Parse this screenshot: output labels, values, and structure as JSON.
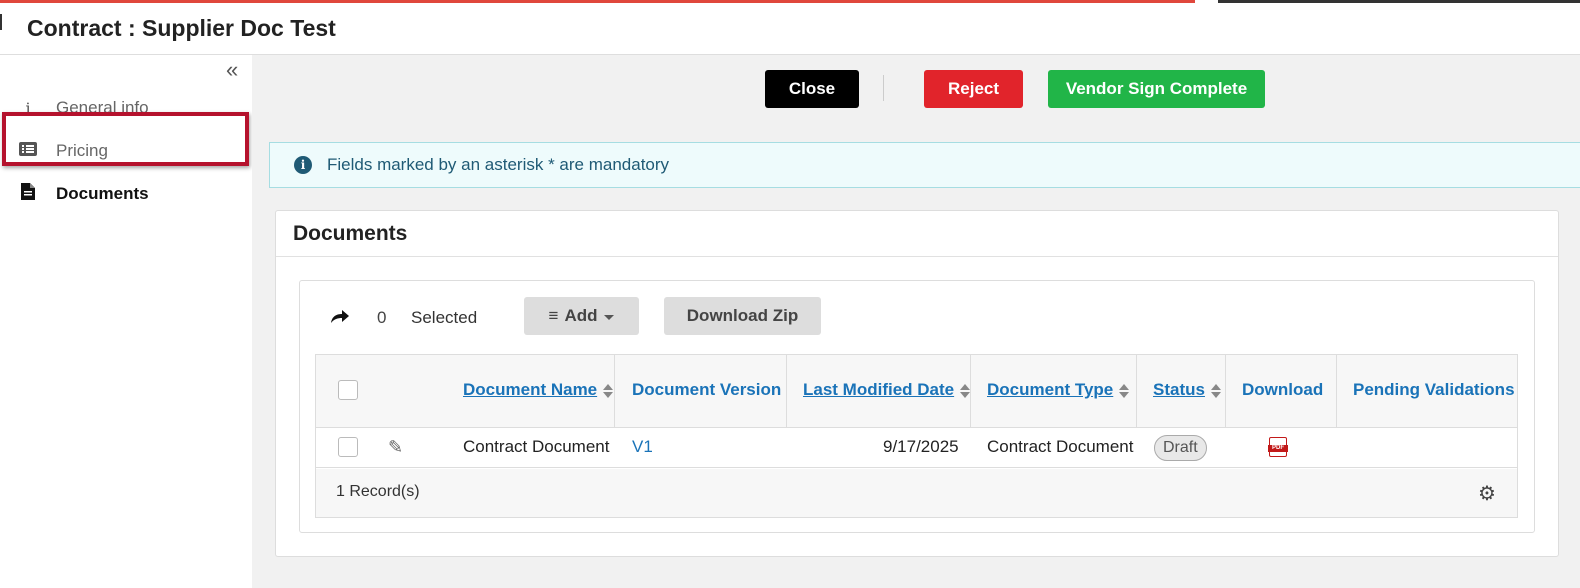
{
  "window": {
    "title": "Contract : Supplier Doc Test"
  },
  "sidebar": {
    "collapse_icon": "«",
    "items": [
      {
        "label": "General info",
        "icon": "info-icon"
      },
      {
        "label": "Pricing",
        "icon": "list-icon"
      },
      {
        "label": "Documents",
        "icon": "document-icon",
        "active": true
      }
    ]
  },
  "actions": {
    "close_label": "Close",
    "reject_label": "Reject",
    "vendor_sign_label": "Vendor Sign Complete",
    "colors": {
      "close": "#000000",
      "reject": "#e1242b",
      "vendor_sign": "#21b548"
    }
  },
  "alert": {
    "message": "Fields marked by an asterisk * are mandatory",
    "icon": "info-circle-icon"
  },
  "documents": {
    "title": "Documents",
    "selected_count": "0",
    "selected_label": "Selected",
    "add_label": "Add",
    "download_zip_label": "Download Zip",
    "columns": {
      "document_name": "Document Name",
      "document_version": "Document Version",
      "last_modified_date": "Last Modified Date",
      "document_type": "Document Type",
      "status": "Status",
      "download": "Download",
      "pending_validations": "Pending Validations"
    },
    "rows": [
      {
        "document_name": "Contract Document",
        "document_version": "V1",
        "last_modified_date": "9/17/2025",
        "document_type": "Contract Document",
        "status": "Draft",
        "download_icon": "pdf-icon",
        "pending_validations": ""
      }
    ],
    "records_label": "1 Record(s)"
  }
}
